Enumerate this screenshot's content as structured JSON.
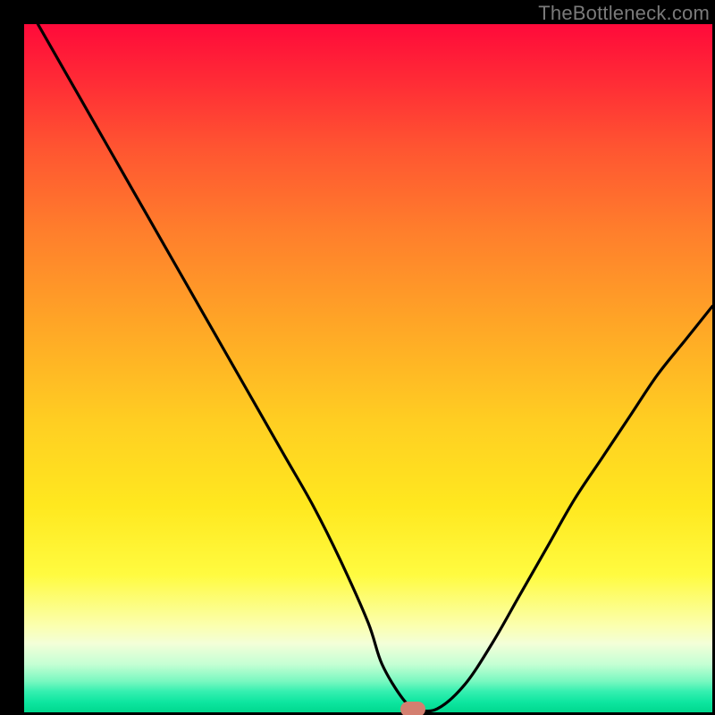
{
  "watermark": "TheBottleneck.com",
  "chart_data": {
    "type": "line",
    "title": "",
    "xlabel": "",
    "ylabel": "",
    "xlim": [
      0,
      100
    ],
    "ylim": [
      0,
      100
    ],
    "series": [
      {
        "name": "bottleneck-curve",
        "x": [
          2,
          6,
          10,
          14,
          18,
          22,
          26,
          30,
          34,
          38,
          42,
          46,
          50,
          52,
          55,
          57,
          60,
          64,
          68,
          72,
          76,
          80,
          84,
          88,
          92,
          96,
          100
        ],
        "y": [
          100,
          93,
          86,
          79,
          72,
          65,
          58,
          51,
          44,
          37,
          30,
          22,
          13,
          7,
          2,
          0.5,
          0.5,
          4,
          10,
          17,
          24,
          31,
          37,
          43,
          49,
          54,
          59
        ]
      }
    ],
    "marker": {
      "x": 56.5,
      "y": 0.5
    },
    "background_gradient": {
      "top": "#ff0a3a",
      "mid": "#ffe81f",
      "bottom": "#00d88e"
    }
  }
}
